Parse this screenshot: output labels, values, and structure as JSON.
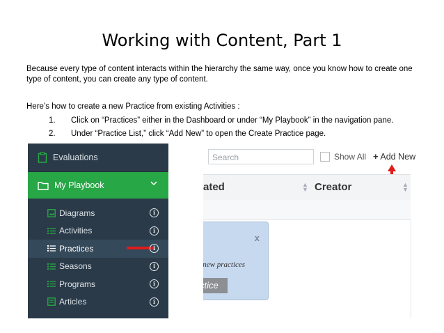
{
  "slide": {
    "title": "Working with Content, Part 1",
    "intro": "Because every type of content interacts within the hierarchy the same way, once you know how to create one type of content, you can create any type of content.",
    "howto": "Here’s how to create a new Practice from existing Activities :",
    "steps": [
      {
        "num": "1.",
        "text": "Click on “Practices” either in the Dashboard or under “My Playbook” in the navigation pane."
      },
      {
        "num": "2.",
        "text": "Under “Practice List,” click “Add New” to open the Create Practice page."
      }
    ]
  },
  "sidebar": {
    "evaluations": "Evaluations",
    "playbook": "My Playbook",
    "items": [
      {
        "label": "Diagrams",
        "icon": "image-icon"
      },
      {
        "label": "Activities",
        "icon": "list-icon"
      },
      {
        "label": "Practices",
        "icon": "list-icon"
      },
      {
        "label": "Seasons",
        "icon": "list-icon"
      },
      {
        "label": "Programs",
        "icon": "list-icon"
      },
      {
        "label": "Articles",
        "icon": "document-icon"
      }
    ],
    "colors": {
      "bg": "#2b3a48",
      "active": "#27a745",
      "marker": "#e01b1b"
    }
  },
  "list_view": {
    "search_placeholder": "Search",
    "show_all": "Show All",
    "add_new": "Add New",
    "col1": "ated",
    "col2": "Creator",
    "tooltip_close": "x",
    "tooltip_text": "g new practices",
    "tooltip_button": "ctice"
  }
}
